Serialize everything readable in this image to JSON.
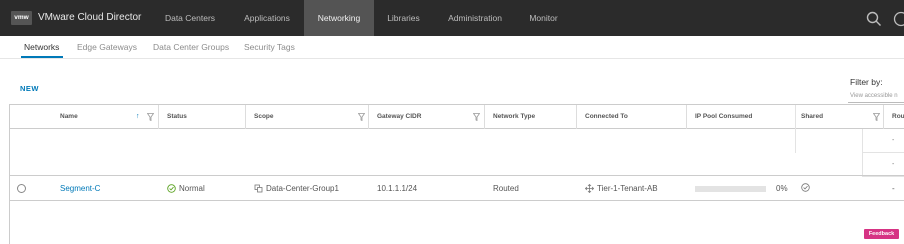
{
  "app": {
    "logo_text": "vmw",
    "title": "VMware Cloud Director"
  },
  "nav": {
    "items": [
      {
        "label": "Data Centers"
      },
      {
        "label": "Applications"
      },
      {
        "label": "Networking"
      },
      {
        "label": "Libraries"
      },
      {
        "label": "Administration"
      },
      {
        "label": "Monitor"
      }
    ],
    "active": "Networking"
  },
  "subtabs": {
    "items": [
      {
        "label": "Networks"
      },
      {
        "label": "Edge Gateways"
      },
      {
        "label": "Data Center Groups"
      },
      {
        "label": "Security Tags"
      }
    ],
    "active": "Networks"
  },
  "toolbar": {
    "new_label": "NEW"
  },
  "filter": {
    "label": "Filter by:",
    "placeholder": "View accessible n"
  },
  "grid": {
    "columns": [
      {
        "label": "Name",
        "sort": "↑"
      },
      {
        "label": "Status"
      },
      {
        "label": "Scope"
      },
      {
        "label": "Gateway CIDR"
      },
      {
        "label": "Network Type"
      },
      {
        "label": "Connected To"
      },
      {
        "label": "IP Pool Consumed"
      },
      {
        "label": "Shared"
      },
      {
        "label": "Rou"
      }
    ],
    "ghost_cells": [
      "-",
      "-"
    ],
    "rows": [
      {
        "name": "Segment-C",
        "status": "Normal",
        "scope": "Data-Center-Group1",
        "gateway_cidr": "10.1.1.1/24",
        "network_type": "Routed",
        "connected_to": "Tier-1-Tenant-AB",
        "ip_pool_consumed": "0%",
        "ip_pool_fraction": 0,
        "shared": "check-circle-icon",
        "rou": "-"
      }
    ]
  },
  "feedback": {
    "label": "Feedback"
  },
  "colors": {
    "accent": "#0079b8",
    "header_bg": "#2b2b2b",
    "active_nav_bg": "#545454",
    "status_ok": "#5aa220",
    "feedback_bg": "#d63384"
  }
}
